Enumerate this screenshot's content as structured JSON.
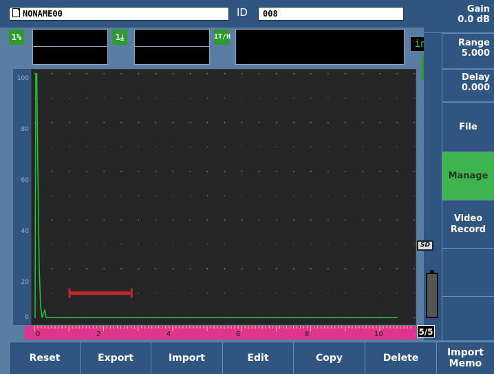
{
  "header": {
    "file_name": "NONAME00",
    "id_label": "ID",
    "id_value": "008"
  },
  "readings": {
    "r1_icon": "1%",
    "r2_icon": "1⤓",
    "r3_icon": "1T/H"
  },
  "units": "in",
  "gate_icon": "1A",
  "parameters": [
    {
      "label": "Gain",
      "value": "0.0 dB"
    },
    {
      "label": "Range",
      "value": "5.000"
    },
    {
      "label": "Delay",
      "value": "0.000"
    }
  ],
  "side_buttons": [
    {
      "label": "File",
      "active": false
    },
    {
      "label": "Manage",
      "active": true
    },
    {
      "label": "Video Record",
      "active": false
    },
    {
      "label": "",
      "active": false
    },
    {
      "label": "",
      "active": false
    }
  ],
  "plot": {
    "y_ticks": [
      "100",
      "80",
      "60",
      "40",
      "20",
      "0"
    ],
    "x_ruler_labels": [
      "0",
      "2",
      "4",
      "6",
      "8",
      "10"
    ],
    "trace_color": "#22cc33",
    "gate_color": "#c02828",
    "gate_start": 1.0,
    "gate_end": 2.8,
    "gate_level": 10
  },
  "storage_icon": "SD",
  "page_indicator": "5/5",
  "bottom_buttons": [
    "Reset",
    "Export",
    "Import",
    "Edit",
    "Copy",
    "Delete",
    "Import Memo"
  ],
  "colors": {
    "accent_green": "#3fb34f",
    "panel_blue": "#2f5580",
    "ruler_magenta": "#e0348f"
  }
}
